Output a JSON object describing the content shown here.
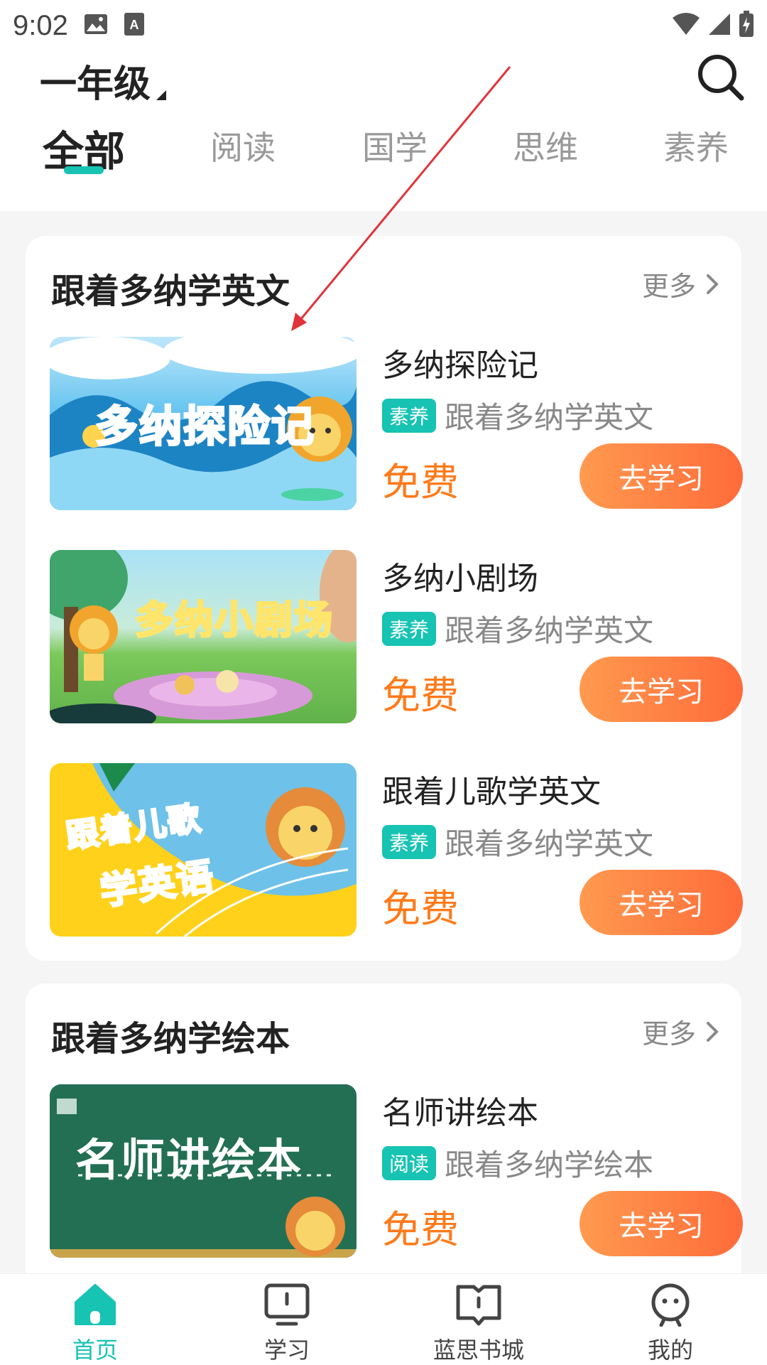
{
  "status_bar": {
    "time": "9:02"
  },
  "header": {
    "grade": "一年级",
    "search_icon": "search-icon"
  },
  "tabs": [
    {
      "label": "全部",
      "active": true
    },
    {
      "label": "阅读",
      "active": false
    },
    {
      "label": "国学",
      "active": false
    },
    {
      "label": "思维",
      "active": false
    },
    {
      "label": "素养",
      "active": false
    }
  ],
  "sections": [
    {
      "title": "跟着多纳学英文",
      "more_label": "更多",
      "items": [
        {
          "thumb_text": "多纳探险记",
          "title": "多纳探险记",
          "tag": "素养",
          "subtitle": "跟着多纳学英文",
          "price": "免费",
          "button": "去学习"
        },
        {
          "thumb_text": "多纳小剧场",
          "title": "多纳小剧场",
          "tag": "素养",
          "subtitle": "跟着多纳学英文",
          "price": "免费",
          "button": "去学习"
        },
        {
          "thumb_text_1": "跟着儿歌",
          "thumb_text_2": "学英语",
          "title": "跟着儿歌学英文",
          "tag": "素养",
          "subtitle": "跟着多纳学英文",
          "price": "免费",
          "button": "去学习"
        }
      ]
    },
    {
      "title": "跟着多纳学绘本",
      "more_label": "更多",
      "items": [
        {
          "thumb_text": "名师讲绘本",
          "title": "名师讲绘本",
          "tag": "阅读",
          "subtitle": "跟着多纳学绘本",
          "price": "免费",
          "button": "去学习"
        }
      ]
    }
  ],
  "bottom_nav": [
    {
      "label": "首页",
      "icon": "home-icon",
      "active": true
    },
    {
      "label": "学习",
      "icon": "monitor-icon",
      "active": false
    },
    {
      "label": "蓝思书城",
      "icon": "book-icon",
      "active": false
    },
    {
      "label": "我的",
      "icon": "profile-icon",
      "active": false
    }
  ],
  "colors": {
    "accent": "#17c3b3",
    "price": "#ff7a1a",
    "button_start": "#ff9a4f",
    "button_end": "#ff6b3a",
    "annotation_arrow": "#e0343a"
  }
}
